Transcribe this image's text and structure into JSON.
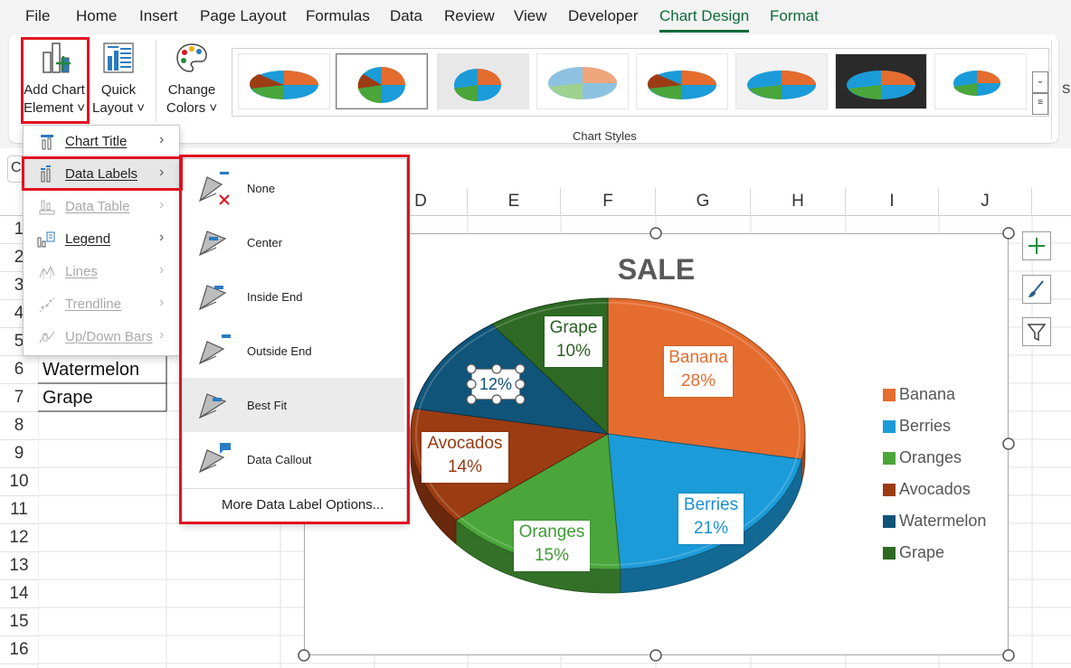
{
  "menu": {
    "tabs": [
      "File",
      "Home",
      "Insert",
      "Page Layout",
      "Formulas",
      "Data",
      "Review",
      "View",
      "Developer",
      "Chart Design",
      "Format"
    ],
    "active_tab": "Chart Design"
  },
  "ribbon": {
    "add_chart_element": [
      "Add Chart",
      "Element ˅"
    ],
    "quick_layout": [
      "Quick",
      "Layout ˅"
    ],
    "change_colors": [
      "Change",
      "Colors ˅"
    ],
    "chart_styles_label": "Chart Styles",
    "cut_off_label": "S"
  },
  "chart_element_menu": {
    "items": [
      {
        "label": "Chart Title",
        "enabled": true,
        "icon": "chart-title-icon"
      },
      {
        "label": "Data Labels",
        "enabled": true,
        "icon": "data-labels-icon",
        "active": true
      },
      {
        "label": "Data Table",
        "enabled": false,
        "icon": "data-table-icon"
      },
      {
        "label": "Legend",
        "enabled": true,
        "icon": "legend-icon"
      },
      {
        "label": "Lines",
        "enabled": false,
        "icon": "lines-icon"
      },
      {
        "label": "Trendline",
        "enabled": false,
        "icon": "trendline-icon"
      },
      {
        "label": "Up/Down Bars",
        "enabled": false,
        "icon": "up-down-bars-icon"
      }
    ]
  },
  "data_labels_submenu": {
    "items": [
      {
        "label": "None",
        "icon": "label-none-icon"
      },
      {
        "label": "Center",
        "icon": "label-center-icon"
      },
      {
        "label": "Inside End",
        "icon": "label-inside-end-icon"
      },
      {
        "label": "Outside End",
        "icon": "label-outside-end-icon"
      },
      {
        "label": "Best Fit",
        "icon": "label-best-fit-icon",
        "hover": true
      },
      {
        "label": "Data Callout",
        "icon": "label-data-callout-icon"
      }
    ],
    "more_options": "More Data Label Options..."
  },
  "sheet": {
    "name_box_partial": "C",
    "columns": [
      "D",
      "E",
      "F",
      "G",
      "H",
      "I",
      "J"
    ],
    "rows": [
      "1",
      "2",
      "3",
      "4",
      "5",
      "6",
      "7",
      "8",
      "9",
      "10",
      "11",
      "12",
      "13",
      "14",
      "15",
      "16"
    ],
    "cells": {
      "A6": "Watermelon",
      "A7": "Grape"
    }
  },
  "chart_data": {
    "type": "pie",
    "title": "SALE",
    "categories": [
      "Banana",
      "Berries",
      "Oranges",
      "Avocados",
      "Watermelon",
      "Grape"
    ],
    "values": [
      28,
      21,
      15,
      14,
      12,
      10
    ],
    "labels": [
      "28%",
      "21%",
      "15%",
      "14%",
      "12%",
      "10%"
    ],
    "colors": [
      "#e46c2e",
      "#1b9bd8",
      "#4aa63a",
      "#9c3c12",
      "#10547a",
      "#2e6a24"
    ],
    "label_colors": [
      "#e46c2e",
      "#1a8fd0",
      "#3f9a35",
      "#953a12",
      "#0d4f78",
      "#2a5f24"
    ],
    "legend_position": "right",
    "style": "3-D pie"
  }
}
